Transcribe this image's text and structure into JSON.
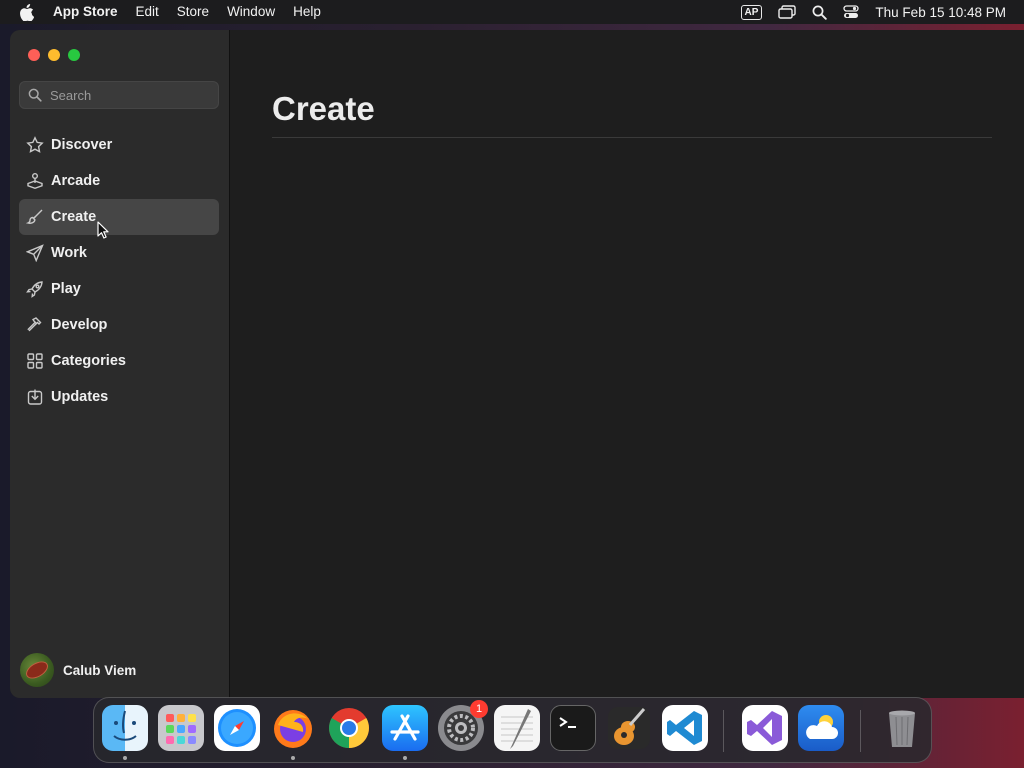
{
  "menubar": {
    "app_name": "App Store",
    "menus": [
      "Edit",
      "Store",
      "Window",
      "Help"
    ],
    "input_source": "AP",
    "clock": "Thu Feb 15  10:48 PM"
  },
  "sidebar": {
    "search_placeholder": "Search",
    "items": [
      {
        "label": "Discover",
        "icon": "star-icon"
      },
      {
        "label": "Arcade",
        "icon": "joystick-icon"
      },
      {
        "label": "Create",
        "icon": "paintbrush-icon"
      },
      {
        "label": "Work",
        "icon": "paperplane-icon"
      },
      {
        "label": "Play",
        "icon": "rocket-icon"
      },
      {
        "label": "Develop",
        "icon": "hammer-icon"
      },
      {
        "label": "Categories",
        "icon": "grid-icon"
      },
      {
        "label": "Updates",
        "icon": "download-icon"
      }
    ],
    "selected": "Create",
    "user_name": "Calub Viem"
  },
  "main": {
    "title": "Create"
  },
  "dock": {
    "apps": [
      "Finder",
      "Launchpad",
      "Safari",
      "Firefox",
      "Google Chrome",
      "App Store",
      "System Settings",
      "TextEdit",
      "Terminal",
      "GarageBand",
      "Visual Studio Code",
      "Visual Studio",
      "Weather",
      "Trash"
    ],
    "system_settings_badge": "1"
  }
}
